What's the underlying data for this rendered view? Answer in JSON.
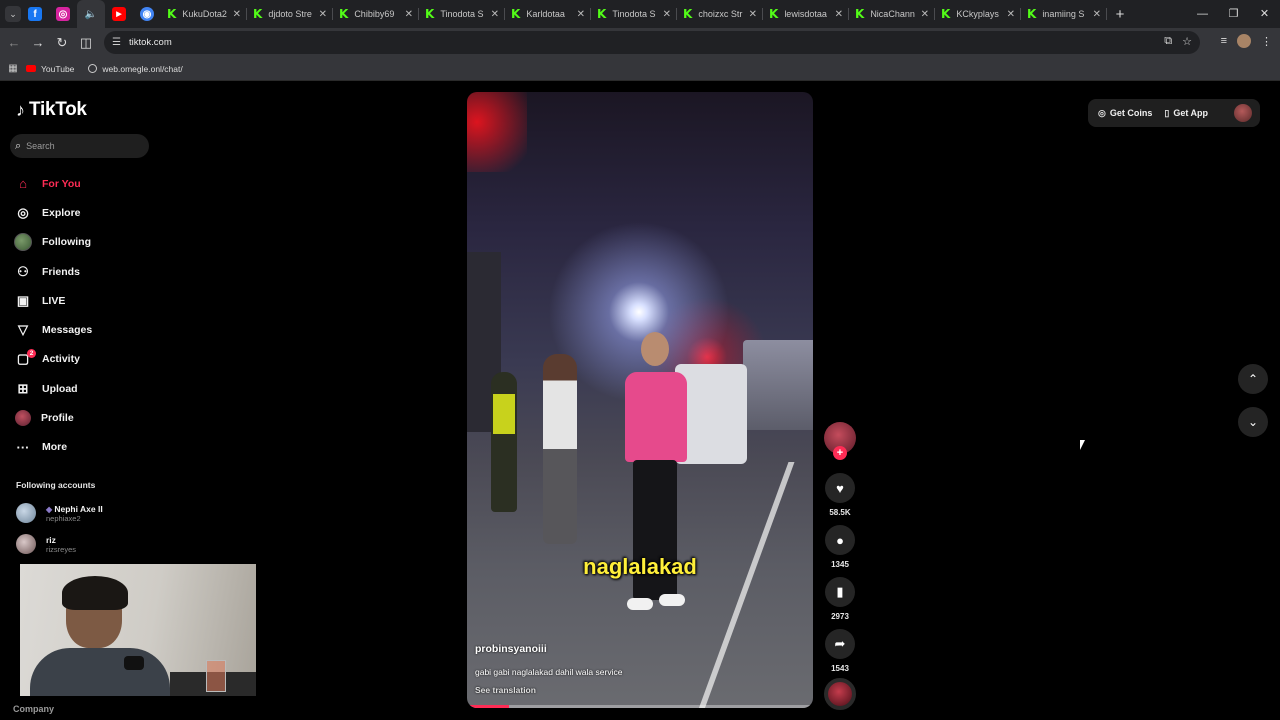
{
  "browser": {
    "pinned_tabs": [
      {
        "icon": "facebook-icon",
        "color": "#1877f2",
        "glyph": "f"
      },
      {
        "icon": "instagram-icon",
        "color": "#d6249f",
        "glyph": "◎"
      },
      {
        "icon": "speaker-icon",
        "color": "#35363a",
        "glyph": "🔊"
      },
      {
        "icon": "youtube-icon",
        "color": "#ff0000",
        "glyph": "▶"
      },
      {
        "icon": "app-icon",
        "color": "#4285f4",
        "glyph": "◉"
      }
    ],
    "tabs": [
      {
        "title": "KukuDota2"
      },
      {
        "title": "djdoto Stre"
      },
      {
        "title": "Chibiby69"
      },
      {
        "title": "Tinodota S"
      },
      {
        "title": "Karldotaa"
      },
      {
        "title": "Tinodota S"
      },
      {
        "title": "choizxc Str"
      },
      {
        "title": "lewisdotaa"
      },
      {
        "title": "NicaChann"
      },
      {
        "title": "KCkyplays"
      },
      {
        "title": "inamiing S"
      }
    ],
    "url": "tiktok.com",
    "bookmarks": [
      {
        "label": "YouTube"
      },
      {
        "label": "web.omegle.onl/chat/"
      }
    ]
  },
  "tiktok": {
    "brand": "TikTok",
    "search_placeholder": "Search",
    "menu": [
      {
        "label": "For You",
        "icon": "home-icon"
      },
      {
        "label": "Explore",
        "icon": "compass-icon"
      },
      {
        "label": "Following",
        "icon": "following-avatar"
      },
      {
        "label": "Friends",
        "icon": "friends-icon"
      },
      {
        "label": "LIVE",
        "icon": "live-icon"
      },
      {
        "label": "Messages",
        "icon": "messages-icon"
      },
      {
        "label": "Activity",
        "icon": "activity-icon",
        "badge": "2"
      },
      {
        "label": "Upload",
        "icon": "upload-icon"
      },
      {
        "label": "Profile",
        "icon": "profile-avatar"
      },
      {
        "label": "More",
        "icon": "more-icon"
      }
    ],
    "following_title": "Following accounts",
    "accounts": [
      {
        "name": "Nephi Axe II",
        "username": "nephiaxe2"
      },
      {
        "name": "riz",
        "username": "rizsreyes"
      }
    ],
    "footer": "Company",
    "video": {
      "overlay_text": "naglalakad",
      "author": "probinsyanoiii",
      "description": "gabi gabi naglalakad dahil wala service",
      "translate": "See translation",
      "progress": 0.12
    },
    "actions": {
      "likes": "58.5K",
      "comments": "1345",
      "saves": "2973",
      "shares": "1543"
    },
    "top": {
      "coins": "Get Coins",
      "app": "Get App"
    },
    "accent": "#fe2c55"
  }
}
